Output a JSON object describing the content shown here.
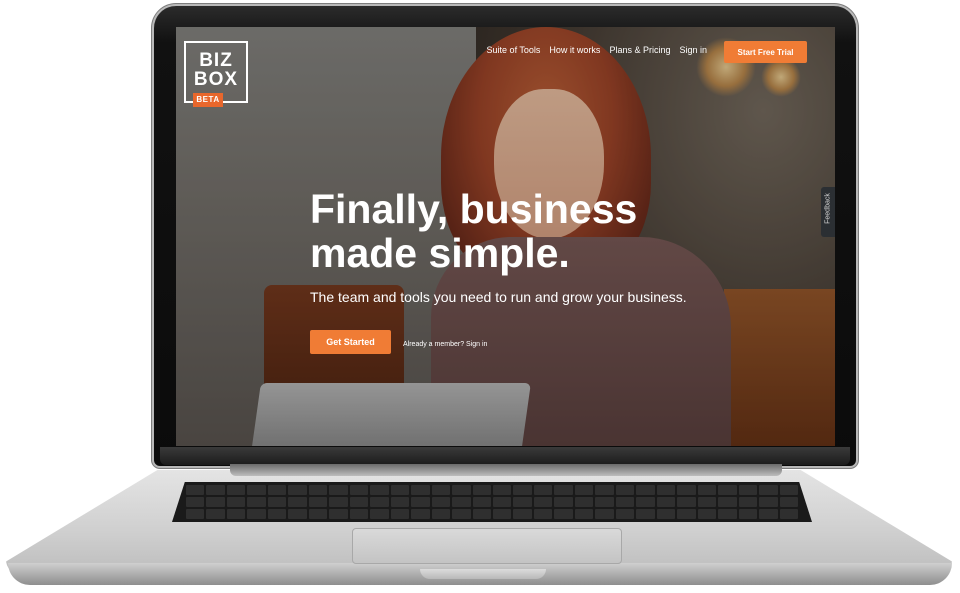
{
  "brand": {
    "logo_line1": "BIZ",
    "logo_line2": "BOX",
    "badge": "BETA"
  },
  "nav": {
    "items": [
      {
        "label": "Suite of Tools"
      },
      {
        "label": "How it works"
      },
      {
        "label": "Plans & Pricing"
      },
      {
        "label": "Sign in"
      }
    ],
    "cta_label": "Start Free Trial"
  },
  "hero": {
    "headline_line1": "Finally, business",
    "headline_line2": "made simple.",
    "subhead": "The team and tools you need to run and grow your business.",
    "cta_label": "Get Started",
    "member_prompt": "Already a member?",
    "member_link": "Sign in"
  },
  "feedback_tab": "Feedback",
  "colors": {
    "accent": "#f07c35",
    "badge": "#e8672c",
    "text": "#ffffff"
  }
}
